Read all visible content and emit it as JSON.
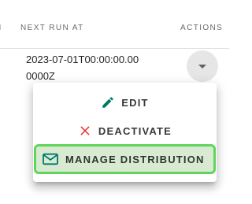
{
  "table": {
    "headers": {
      "partial": "N",
      "next_run_at": "NEXT RUN AT",
      "actions": "ACTIONS"
    },
    "row": {
      "next_run_at": "2023-07-01T00:00:00.000000Z"
    }
  },
  "menu": {
    "items": [
      {
        "label": "EDIT",
        "icon": "pencil-icon",
        "color": "#00796b"
      },
      {
        "label": "DEACTIVATE",
        "icon": "close-icon",
        "color": "#e53935"
      },
      {
        "label": "MANAGE DISTRIBUTION",
        "icon": "mail-icon",
        "color": "#00796b",
        "highlighted": true
      }
    ]
  },
  "colors": {
    "highlight_border": "#5fd65a",
    "highlight_fill": "#d8ead2"
  }
}
